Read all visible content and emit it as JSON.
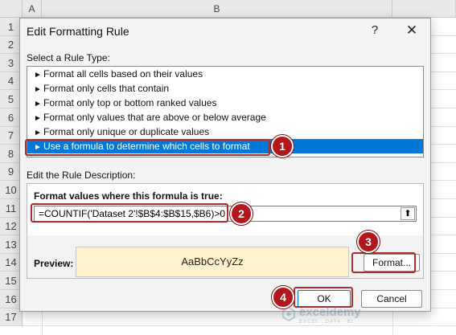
{
  "sheet": {
    "columns": [
      "A",
      "B"
    ],
    "rows": [
      "1",
      "2",
      "3",
      "4",
      "5",
      "6",
      "7",
      "8",
      "9",
      "10",
      "11",
      "12",
      "13",
      "14",
      "15",
      "16",
      "17"
    ]
  },
  "dialog": {
    "title": "Edit Formatting Rule",
    "help_glyph": "?",
    "close_glyph": "✕",
    "rule_type_label": "Select a Rule Type:",
    "rule_types": [
      "Format all cells based on their values",
      "Format only cells that contain",
      "Format only top or bottom ranked values",
      "Format only values that are above or below average",
      "Format only unique or duplicate values",
      "Use a formula to determine which cells to format"
    ],
    "selected_rule_index": 5,
    "description_label": "Edit the Rule Description:",
    "formula_label": "Format values where this formula is true:",
    "formula_value": "=COUNTIF('Dataset 2'!$B$4:$B$15,$B6)>0",
    "ref_glyph": "⬆",
    "preview_label": "Preview:",
    "preview_text": "AaBbCcYyZz",
    "preview_fill": "#fff2cc",
    "format_button": "Format...",
    "ok_button": "OK",
    "cancel_button": "Cancel"
  },
  "annotations": {
    "color": "#b3171b",
    "badges": [
      "1",
      "2",
      "3",
      "4"
    ]
  },
  "watermark": {
    "name": "exceldemy",
    "tagline": "EXCEL · DATA · BI"
  }
}
